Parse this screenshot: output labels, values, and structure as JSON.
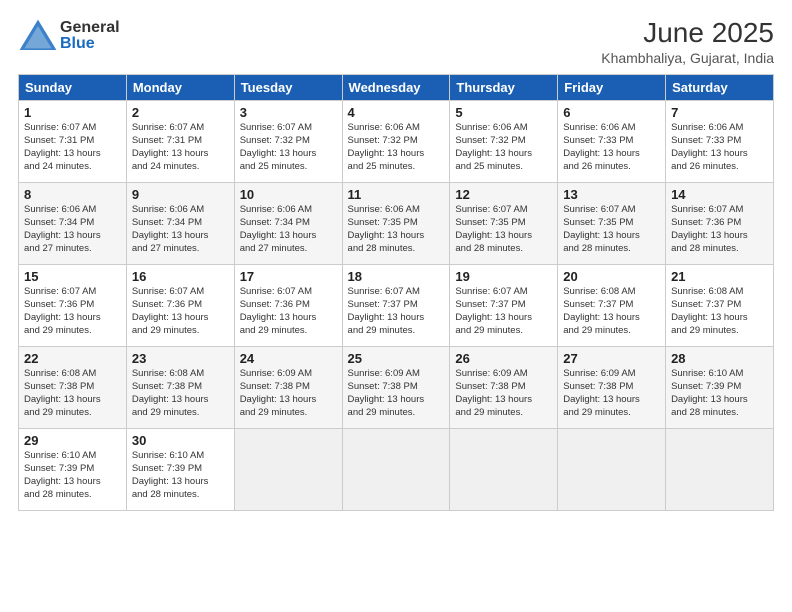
{
  "header": {
    "logo_general": "General",
    "logo_blue": "Blue",
    "month_title": "June 2025",
    "location": "Khambhaliya, Gujarat, India"
  },
  "days_of_week": [
    "Sunday",
    "Monday",
    "Tuesday",
    "Wednesday",
    "Thursday",
    "Friday",
    "Saturday"
  ],
  "weeks": [
    [
      {
        "day": "1",
        "sunrise": "Sunrise: 6:07 AM",
        "sunset": "Sunset: 7:31 PM",
        "daylight": "Daylight: 13 hours",
        "extra": "and 24 minutes."
      },
      {
        "day": "2",
        "sunrise": "Sunrise: 6:07 AM",
        "sunset": "Sunset: 7:31 PM",
        "daylight": "Daylight: 13 hours",
        "extra": "and 24 minutes."
      },
      {
        "day": "3",
        "sunrise": "Sunrise: 6:07 AM",
        "sunset": "Sunset: 7:32 PM",
        "daylight": "Daylight: 13 hours",
        "extra": "and 25 minutes."
      },
      {
        "day": "4",
        "sunrise": "Sunrise: 6:06 AM",
        "sunset": "Sunset: 7:32 PM",
        "daylight": "Daylight: 13 hours",
        "extra": "and 25 minutes."
      },
      {
        "day": "5",
        "sunrise": "Sunrise: 6:06 AM",
        "sunset": "Sunset: 7:32 PM",
        "daylight": "Daylight: 13 hours",
        "extra": "and 25 minutes."
      },
      {
        "day": "6",
        "sunrise": "Sunrise: 6:06 AM",
        "sunset": "Sunset: 7:33 PM",
        "daylight": "Daylight: 13 hours",
        "extra": "and 26 minutes."
      },
      {
        "day": "7",
        "sunrise": "Sunrise: 6:06 AM",
        "sunset": "Sunset: 7:33 PM",
        "daylight": "Daylight: 13 hours",
        "extra": "and 26 minutes."
      }
    ],
    [
      {
        "day": "8",
        "sunrise": "Sunrise: 6:06 AM",
        "sunset": "Sunset: 7:34 PM",
        "daylight": "Daylight: 13 hours",
        "extra": "and 27 minutes."
      },
      {
        "day": "9",
        "sunrise": "Sunrise: 6:06 AM",
        "sunset": "Sunset: 7:34 PM",
        "daylight": "Daylight: 13 hours",
        "extra": "and 27 minutes."
      },
      {
        "day": "10",
        "sunrise": "Sunrise: 6:06 AM",
        "sunset": "Sunset: 7:34 PM",
        "daylight": "Daylight: 13 hours",
        "extra": "and 27 minutes."
      },
      {
        "day": "11",
        "sunrise": "Sunrise: 6:06 AM",
        "sunset": "Sunset: 7:35 PM",
        "daylight": "Daylight: 13 hours",
        "extra": "and 28 minutes."
      },
      {
        "day": "12",
        "sunrise": "Sunrise: 6:07 AM",
        "sunset": "Sunset: 7:35 PM",
        "daylight": "Daylight: 13 hours",
        "extra": "and 28 minutes."
      },
      {
        "day": "13",
        "sunrise": "Sunrise: 6:07 AM",
        "sunset": "Sunset: 7:35 PM",
        "daylight": "Daylight: 13 hours",
        "extra": "and 28 minutes."
      },
      {
        "day": "14",
        "sunrise": "Sunrise: 6:07 AM",
        "sunset": "Sunset: 7:36 PM",
        "daylight": "Daylight: 13 hours",
        "extra": "and 28 minutes."
      }
    ],
    [
      {
        "day": "15",
        "sunrise": "Sunrise: 6:07 AM",
        "sunset": "Sunset: 7:36 PM",
        "daylight": "Daylight: 13 hours",
        "extra": "and 29 minutes."
      },
      {
        "day": "16",
        "sunrise": "Sunrise: 6:07 AM",
        "sunset": "Sunset: 7:36 PM",
        "daylight": "Daylight: 13 hours",
        "extra": "and 29 minutes."
      },
      {
        "day": "17",
        "sunrise": "Sunrise: 6:07 AM",
        "sunset": "Sunset: 7:36 PM",
        "daylight": "Daylight: 13 hours",
        "extra": "and 29 minutes."
      },
      {
        "day": "18",
        "sunrise": "Sunrise: 6:07 AM",
        "sunset": "Sunset: 7:37 PM",
        "daylight": "Daylight: 13 hours",
        "extra": "and 29 minutes."
      },
      {
        "day": "19",
        "sunrise": "Sunrise: 6:07 AM",
        "sunset": "Sunset: 7:37 PM",
        "daylight": "Daylight: 13 hours",
        "extra": "and 29 minutes."
      },
      {
        "day": "20",
        "sunrise": "Sunrise: 6:08 AM",
        "sunset": "Sunset: 7:37 PM",
        "daylight": "Daylight: 13 hours",
        "extra": "and 29 minutes."
      },
      {
        "day": "21",
        "sunrise": "Sunrise: 6:08 AM",
        "sunset": "Sunset: 7:37 PM",
        "daylight": "Daylight: 13 hours",
        "extra": "and 29 minutes."
      }
    ],
    [
      {
        "day": "22",
        "sunrise": "Sunrise: 6:08 AM",
        "sunset": "Sunset: 7:38 PM",
        "daylight": "Daylight: 13 hours",
        "extra": "and 29 minutes."
      },
      {
        "day": "23",
        "sunrise": "Sunrise: 6:08 AM",
        "sunset": "Sunset: 7:38 PM",
        "daylight": "Daylight: 13 hours",
        "extra": "and 29 minutes."
      },
      {
        "day": "24",
        "sunrise": "Sunrise: 6:09 AM",
        "sunset": "Sunset: 7:38 PM",
        "daylight": "Daylight: 13 hours",
        "extra": "and 29 minutes."
      },
      {
        "day": "25",
        "sunrise": "Sunrise: 6:09 AM",
        "sunset": "Sunset: 7:38 PM",
        "daylight": "Daylight: 13 hours",
        "extra": "and 29 minutes."
      },
      {
        "day": "26",
        "sunrise": "Sunrise: 6:09 AM",
        "sunset": "Sunset: 7:38 PM",
        "daylight": "Daylight: 13 hours",
        "extra": "and 29 minutes."
      },
      {
        "day": "27",
        "sunrise": "Sunrise: 6:09 AM",
        "sunset": "Sunset: 7:38 PM",
        "daylight": "Daylight: 13 hours",
        "extra": "and 29 minutes."
      },
      {
        "day": "28",
        "sunrise": "Sunrise: 6:10 AM",
        "sunset": "Sunset: 7:39 PM",
        "daylight": "Daylight: 13 hours",
        "extra": "and 28 minutes."
      }
    ],
    [
      {
        "day": "29",
        "sunrise": "Sunrise: 6:10 AM",
        "sunset": "Sunset: 7:39 PM",
        "daylight": "Daylight: 13 hours",
        "extra": "and 28 minutes."
      },
      {
        "day": "30",
        "sunrise": "Sunrise: 6:10 AM",
        "sunset": "Sunset: 7:39 PM",
        "daylight": "Daylight: 13 hours",
        "extra": "and 28 minutes."
      },
      null,
      null,
      null,
      null,
      null
    ]
  ]
}
